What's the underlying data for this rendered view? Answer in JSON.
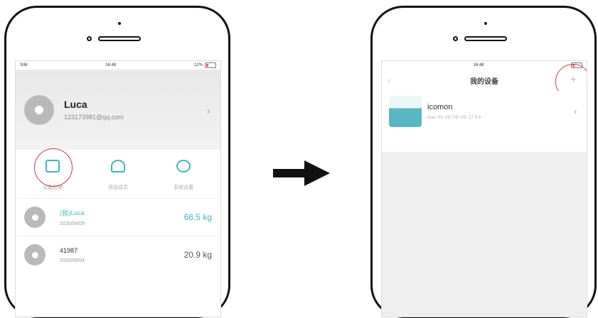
{
  "left_phone": {
    "status": {
      "left": "\t SIM \t",
      "time": "16:48",
      "battery": "12%"
    },
    "profile": {
      "name": "Luca",
      "email": "123173981@qq.com"
    },
    "menu": [
      {
        "label": "设备管理",
        "icon": "device-manage-icon"
      },
      {
        "label": "添加成员",
        "icon": "add-member-icon"
      },
      {
        "label": "系统设置",
        "icon": "settings-icon"
      }
    ],
    "records": [
      {
        "name": "(我)Luca",
        "date": "2020/04/09",
        "weight": "66.5 kg",
        "accent": true
      },
      {
        "name": "41987",
        "date": "2020/06/04",
        "weight": "20.9 kg",
        "accent": false
      }
    ]
  },
  "right_phone": {
    "status": {
      "time": "16:48"
    },
    "nav": {
      "title": "我的设备",
      "plus": "+",
      "back": "‹"
    },
    "device": {
      "name": "icomon",
      "mac": "mac:00:4D:0D:0D:17:E4"
    }
  },
  "colors": {
    "accent": "#3bb8c8",
    "highlight": "#d63a3a"
  }
}
